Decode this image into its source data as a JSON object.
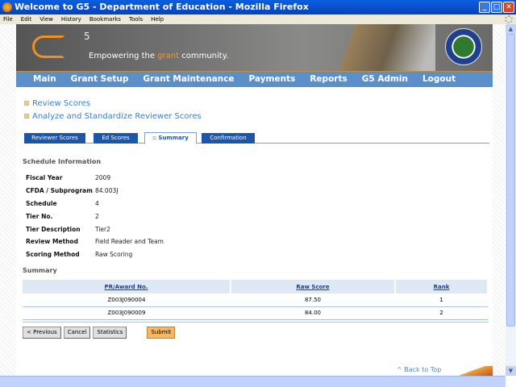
{
  "window": {
    "title": "Welcome to G5 - Department of Education - Mozilla Firefox"
  },
  "menu": [
    "File",
    "Edit",
    "View",
    "History",
    "Bookmarks",
    "Tools",
    "Help"
  ],
  "banner": {
    "logo_sup": "5",
    "tagline_pre": "Empowering the ",
    "tagline_accent": "grant",
    "tagline_post": " community."
  },
  "nav": [
    "Main",
    "Grant Setup",
    "Grant Maintenance",
    "Payments",
    "Reports",
    "G5 Admin",
    "Logout"
  ],
  "links": [
    "Review Scores",
    "Analyze and Standardize Reviewer Scores"
  ],
  "tabs": [
    "Reviewer Scores",
    "Ed Scores",
    "Summary",
    "Confirmation"
  ],
  "schedule": {
    "heading": "Schedule Information",
    "rows": [
      {
        "k": "Fiscal Year",
        "v": "2009"
      },
      {
        "k": "CFDA / Subprogram",
        "v": "84.003J"
      },
      {
        "k": "Schedule",
        "v": "4"
      },
      {
        "k": "Tier No.",
        "v": "2"
      },
      {
        "k": "Tier Description",
        "v": "Tier2"
      },
      {
        "k": "Review Method",
        "v": "Field Reader and Team"
      },
      {
        "k": "Scoring Method",
        "v": "Raw Scoring"
      }
    ]
  },
  "summary": {
    "heading": "Summary",
    "columns": [
      "PR/Award No.",
      "Raw Score",
      "Rank"
    ],
    "rows": [
      [
        "Z003J090004",
        "87.50",
        "1"
      ],
      [
        "Z003J090009",
        "84.00",
        "2"
      ]
    ]
  },
  "buttons": {
    "previous": "< Previous",
    "cancel": "Cancel",
    "statistics": "Statistics",
    "submit": "Submit"
  },
  "back_to_top": "^ Back to Top"
}
